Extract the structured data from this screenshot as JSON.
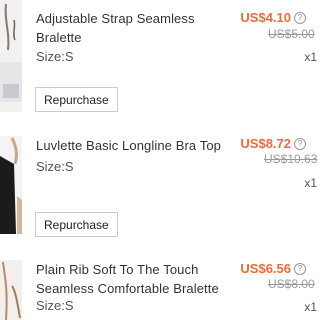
{
  "items": [
    {
      "title": "Adjustable Strap Seamless Bralette",
      "size": "Size:S",
      "price": "US$4.10",
      "original_price": "US$5.00",
      "quantity": "x1",
      "action_label": "Repurchase",
      "thumbnail_icon": "product-photo-bralette"
    },
    {
      "title": "Luvlette Basic Longline Bra Top",
      "size": "Size:S",
      "price": "US$8.72",
      "original_price": "US$10.63",
      "quantity": "x1",
      "action_label": "Repurchase",
      "thumbnail_icon": "product-photo-bra-top"
    },
    {
      "title": "Plain Rib Soft To The Touch Seamless Comfortable Bralette",
      "size": "Size:S",
      "price": "US$6.56",
      "original_price": "US$8.00",
      "quantity": "x1",
      "thumbnail_icon": "product-photo-rib-bralette"
    }
  ],
  "colors": {
    "price": "#ee6a3b",
    "strikethrough": "#999999"
  },
  "price_help_icon": "help-circle-icon"
}
